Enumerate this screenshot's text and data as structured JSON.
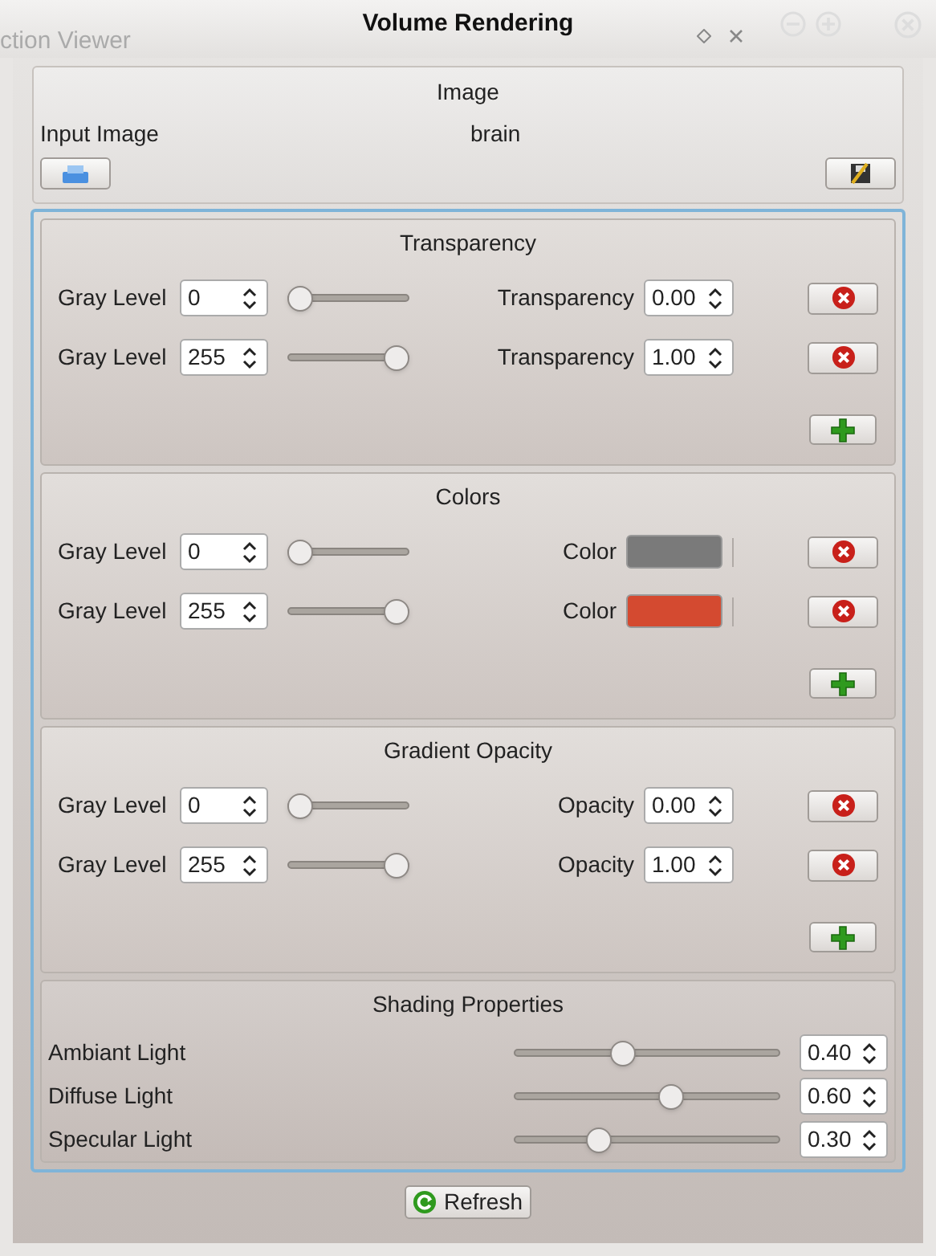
{
  "window": {
    "title": "Volume Rendering",
    "background_title": "ction Viewer"
  },
  "image": {
    "title": "Image",
    "label": "Input Image",
    "value": "brain"
  },
  "sections": [
    {
      "title": "Transparency",
      "rows": [
        {
          "kind": "spin",
          "gray_label": "Gray Level",
          "gray_value": "0",
          "level": 0,
          "value_label": "Transparency",
          "value": "0.00"
        },
        {
          "kind": "spin",
          "gray_label": "Gray Level",
          "gray_value": "255",
          "level": 1,
          "value_label": "Transparency",
          "value": "1.00"
        }
      ]
    },
    {
      "title": "Colors",
      "rows": [
        {
          "kind": "color",
          "gray_label": "Gray Level",
          "gray_value": "0",
          "level": 0,
          "value_label": "Color",
          "color": "#7a7a7a"
        },
        {
          "kind": "color",
          "gray_label": "Gray Level",
          "gray_value": "255",
          "level": 1,
          "value_label": "Color",
          "color": "#d44a30"
        }
      ]
    },
    {
      "title": "Gradient Opacity",
      "rows": [
        {
          "kind": "spin",
          "gray_label": "Gray Level",
          "gray_value": "0",
          "level": 0,
          "value_label": "Opacity",
          "value": "0.00"
        },
        {
          "kind": "spin",
          "gray_label": "Gray Level",
          "gray_value": "255",
          "level": 1,
          "value_label": "Opacity",
          "value": "1.00"
        }
      ]
    }
  ],
  "shading": {
    "title": "Shading Properties",
    "rows": [
      {
        "label": "Ambiant Light",
        "level": 0.4,
        "value": "0.40"
      },
      {
        "label": "Diffuse Light",
        "level": 0.6,
        "value": "0.60"
      },
      {
        "label": "Specular Light",
        "level": 0.3,
        "value": "0.30"
      }
    ]
  },
  "refresh": "Refresh"
}
